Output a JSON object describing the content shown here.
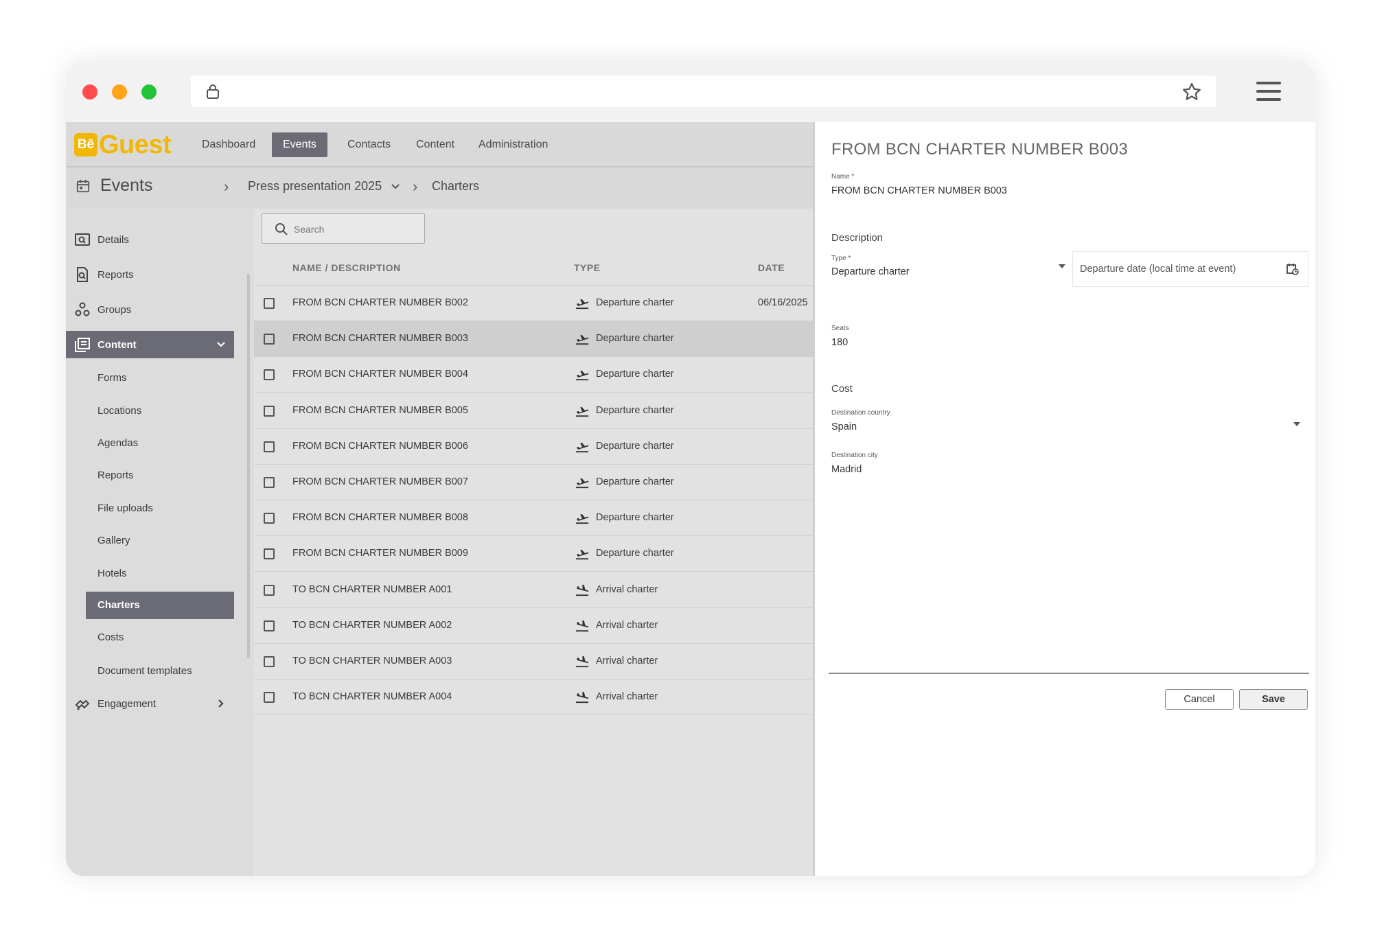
{
  "app": {
    "logo_be": "Bē",
    "logo_text": "Guest"
  },
  "nav": {
    "items": [
      "Dashboard",
      "Events",
      "Contacts",
      "Content",
      "Administration"
    ],
    "active": "Events"
  },
  "breadcrumb": {
    "root": "Events",
    "event": "Press presentation 2025",
    "section": "Charters"
  },
  "sidebar": {
    "items": [
      "Details",
      "Reports",
      "Groups",
      "Content"
    ],
    "content_subitems": [
      "Forms",
      "Locations",
      "Agendas",
      "Reports",
      "File uploads",
      "Gallery",
      "Hotels",
      "Charters",
      "Costs",
      "Document templates"
    ],
    "engagement": "Engagement"
  },
  "search": {
    "placeholder": "Search"
  },
  "table": {
    "columns": [
      "NAME / DESCRIPTION",
      "TYPE",
      "DATE"
    ],
    "rows": [
      {
        "name": "FROM BCN CHARTER NUMBER B002",
        "type": "Departure charter",
        "date": "06/16/2025"
      },
      {
        "name": "FROM BCN CHARTER NUMBER B003",
        "type": "Departure charter",
        "date": ""
      },
      {
        "name": "FROM BCN CHARTER NUMBER B004",
        "type": "Departure charter",
        "date": ""
      },
      {
        "name": "FROM BCN CHARTER NUMBER B005",
        "type": "Departure charter",
        "date": ""
      },
      {
        "name": "FROM BCN CHARTER NUMBER B006",
        "type": "Departure charter",
        "date": ""
      },
      {
        "name": "FROM BCN CHARTER NUMBER B007",
        "type": "Departure charter",
        "date": ""
      },
      {
        "name": "FROM BCN CHARTER NUMBER B008",
        "type": "Departure charter",
        "date": ""
      },
      {
        "name": "FROM BCN CHARTER NUMBER B009",
        "type": "Departure charter",
        "date": ""
      },
      {
        "name": "TO BCN CHARTER NUMBER A001",
        "type": "Arrival charter",
        "date": ""
      },
      {
        "name": "TO BCN CHARTER NUMBER A002",
        "type": "Arrival charter",
        "date": ""
      },
      {
        "name": "TO BCN CHARTER NUMBER A003",
        "type": "Arrival charter",
        "date": ""
      },
      {
        "name": "TO BCN CHARTER NUMBER A004",
        "type": "Arrival charter",
        "date": ""
      }
    ]
  },
  "panel": {
    "title": "FROM BCN CHARTER NUMBER B003",
    "name_label": "Name *",
    "name_value": "FROM BCN CHARTER NUMBER B003",
    "description_label": "Description",
    "type_label": "Type *",
    "type_value": "Departure charter",
    "departure_date_placeholder": "Departure date (local time at event)",
    "seats_label": "Seats",
    "seats_value": "180",
    "cost_label": "Cost",
    "country_label": "Destination country",
    "country_value": "Spain",
    "city_label": "Destination city",
    "city_value": "Madrid",
    "cancel_label": "Cancel",
    "save_label": "Save"
  },
  "colors": {
    "brand": "#f2b705",
    "active_nav": "#6b6b75"
  }
}
